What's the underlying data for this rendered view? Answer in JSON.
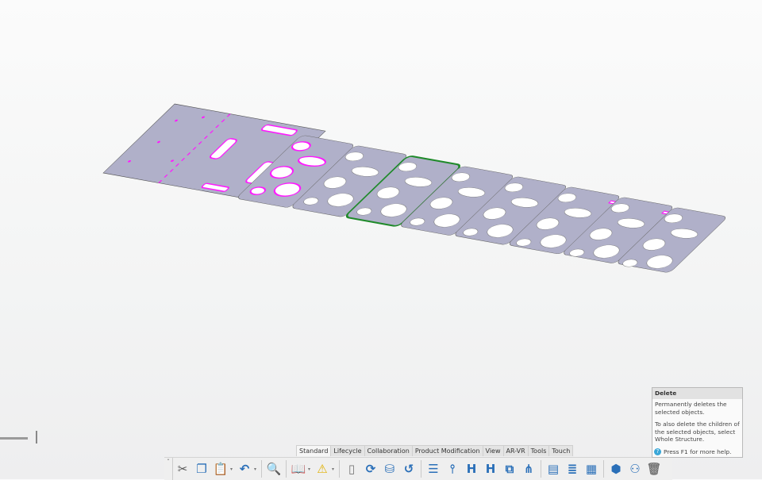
{
  "toolbar_tabs": [
    {
      "label": "Standard",
      "active": true
    },
    {
      "label": "Lifecycle"
    },
    {
      "label": "Collaboration"
    },
    {
      "label": "Product Modification"
    },
    {
      "label": "View"
    },
    {
      "label": "AR-VR"
    },
    {
      "label": "Tools"
    },
    {
      "label": "Touch"
    }
  ],
  "toolbar_icons": [
    "cut-icon",
    "copy-icon",
    "paste-icon",
    "undo-icon",
    "search-zoom-icon",
    "catalog-book-icon",
    "update-warning-icon",
    "new-document-icon",
    "sync-icon",
    "database-clock-icon",
    "history-icon",
    "structure-list-icon",
    "insert-node-icon",
    "insert-existing-icon",
    "insert-new-product-icon",
    "replace-icon",
    "tree-expand-icon",
    "properties-list-icon",
    "reorder-icon",
    "table-icon",
    "3d-part-icon",
    "relations-icon",
    "delete-icon"
  ],
  "tooltip": {
    "title": "Delete",
    "line1": "Permanently deletes the selected objects.",
    "line2": "To also delete the children of the selected objects, select Whole Structure.",
    "help": "Press F1 for more help."
  },
  "colors": {
    "part_fill": "#b0b0c9",
    "highlight": "#ff19ff",
    "selected": "#1f8a2a"
  }
}
